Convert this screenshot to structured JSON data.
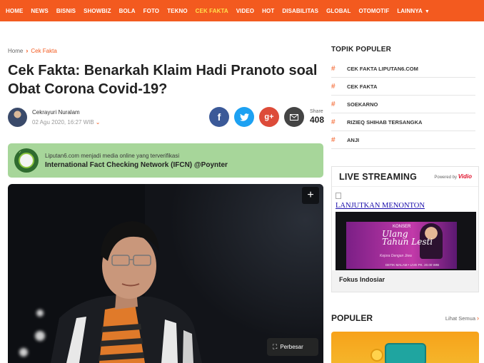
{
  "nav": {
    "items": [
      "HOME",
      "NEWS",
      "BISNIS",
      "SHOWBIZ",
      "BOLA",
      "FOTO",
      "TEKNO",
      "CEK FAKTA",
      "VIDEO",
      "HOT",
      "DISABILITAS",
      "GLOBAL",
      "OTOMOTIF",
      "LAINNYA"
    ],
    "active": "CEK FAKTA",
    "accent": "#f35a1f",
    "active_color": "#ffe14d"
  },
  "breadcrumb": {
    "home": "Home",
    "current": "Cek Fakta"
  },
  "article": {
    "title": "Cek Fakta: Benarkah Klaim Hadi Pranoto soal Obat Corona Covid-19?",
    "author": "Cekrayuri Nuralam",
    "date": "02 Agu 2020, 16:27 WIB"
  },
  "share": {
    "label": "Share",
    "count": "408",
    "icons": [
      "facebook-icon",
      "twitter-icon",
      "google-plus-icon",
      "mail-icon"
    ]
  },
  "ifcn": {
    "line1": "Liputan6.com menjadi media online yang terverifikasi",
    "line2": "International Fact Checking Network (IFCN) @Poynter"
  },
  "hero": {
    "enlarge_label": "Perbesar"
  },
  "sidebar": {
    "topik_title": "TOPIK POPULER",
    "topics": [
      "CEK FAKTA LIPUTAN6.COM",
      "CEK FAKTA",
      "SOEKARNO",
      "RIZIEQ SHIHAB TERSANGKA",
      "ANJI"
    ],
    "live": {
      "title": "LIVE STREAMING",
      "powered_by": "Powered by",
      "brand": "Vidio",
      "link_text": "LANJUTKAN MENONTON",
      "thumb_kicker": "KONSER",
      "thumb_title_1": "Ulang",
      "thumb_title_2": "Tahun",
      "thumb_title_3": "Lesti",
      "thumb_sub": "Kejora Dengan Jiwa",
      "thumb_bottom": "DETIK MALAM • LIVE PK. 20.00 WIB",
      "caption": "Fokus Indosiar"
    },
    "populer": {
      "title": "POPULER",
      "more": "Lihat Semua"
    }
  }
}
